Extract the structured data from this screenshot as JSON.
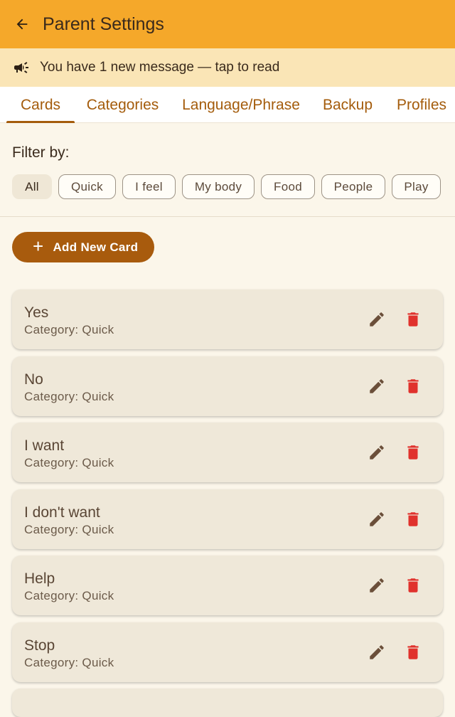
{
  "appbar": {
    "title": "Parent Settings",
    "back_icon": "arrow-left-icon"
  },
  "banner": {
    "text": "You have 1 new message — tap to read",
    "icon": "megaphone-icon"
  },
  "tabs": [
    {
      "label": "Cards",
      "active": true
    },
    {
      "label": "Categories",
      "active": false
    },
    {
      "label": "Language/Phrase",
      "active": false
    },
    {
      "label": "Backup",
      "active": false
    },
    {
      "label": "Profiles",
      "active": false
    }
  ],
  "filter": {
    "label": "Filter by:",
    "chips": [
      {
        "label": "All",
        "selected": true
      },
      {
        "label": "Quick",
        "selected": false
      },
      {
        "label": "I feel",
        "selected": false
      },
      {
        "label": "My body",
        "selected": false
      },
      {
        "label": "Food",
        "selected": false
      },
      {
        "label": "People",
        "selected": false
      },
      {
        "label": "Play",
        "selected": false
      }
    ]
  },
  "add_button": {
    "label": "Add New Card"
  },
  "cards": [
    {
      "title": "Yes",
      "category": "Category: Quick"
    },
    {
      "title": "No",
      "category": "Category: Quick"
    },
    {
      "title": "I want",
      "category": "Category: Quick"
    },
    {
      "title": "I don't want",
      "category": "Category: Quick"
    },
    {
      "title": "Help",
      "category": "Category: Quick"
    },
    {
      "title": "Stop",
      "category": "Category: Quick"
    }
  ],
  "colors": {
    "appbar": "#f5a82a",
    "banner": "#fae5b6",
    "accent": "#a45c0c",
    "edit_icon": "#6b4f3a",
    "delete_icon": "#e0322d",
    "card": "#efe8d9"
  }
}
